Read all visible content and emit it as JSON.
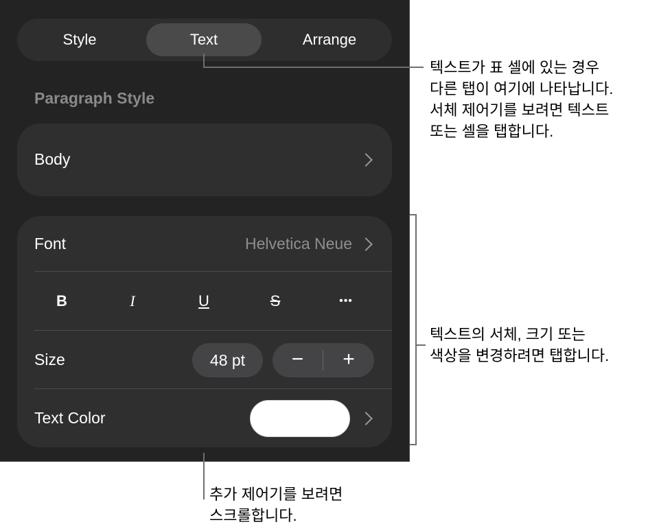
{
  "tabs": {
    "style": "Style",
    "text": "Text",
    "arrange": "Arrange"
  },
  "paragraph_style": {
    "heading": "Paragraph Style",
    "value": "Body"
  },
  "font": {
    "label": "Font",
    "value": "Helvetica Neue"
  },
  "format_buttons": {
    "bold": "B",
    "italic": "I",
    "underline": "U",
    "strikethrough": "S",
    "more": "•••"
  },
  "size": {
    "label": "Size",
    "value": "48 pt",
    "decrease": "−",
    "increase": "+"
  },
  "text_color": {
    "label": "Text Color",
    "swatch": "#ffffff"
  },
  "callouts": {
    "tab_note_1": "텍스트가 표 셀에 있는 경우",
    "tab_note_2": "다른 탭이 여기에 나타납니다.",
    "tab_note_3": "서체 제어기를 보려면 텍스트",
    "tab_note_4": "또는 셀을 탭합니다.",
    "font_note_1": "텍스트의 서체, 크기 또는",
    "font_note_2": "색상을 변경하려면 탭합니다.",
    "scroll_note_1": "추가 제어기를 보려면",
    "scroll_note_2": "스크롤합니다."
  }
}
